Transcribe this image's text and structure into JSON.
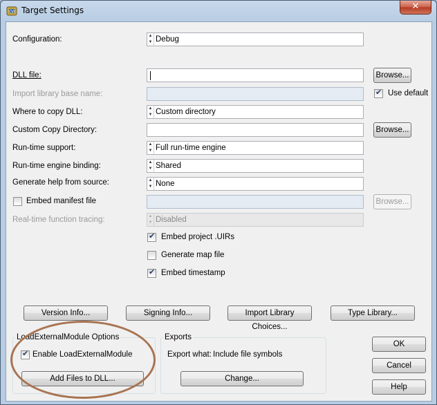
{
  "window": {
    "title": "Target Settings",
    "close_label": "✕"
  },
  "fields": {
    "configuration": {
      "label": "Configuration:",
      "value": "Debug"
    },
    "dll_file": {
      "label": "DLL file:",
      "value": "",
      "browse": "Browse..."
    },
    "import_library": {
      "label": "Import library base name:",
      "value": "",
      "use_default": "Use default",
      "use_default_checked": true
    },
    "where_to_copy": {
      "label": "Where to copy DLL:",
      "value": "Custom directory"
    },
    "custom_copy_dir": {
      "label": "Custom Copy Directory:",
      "value": "",
      "browse": "Browse..."
    },
    "runtime_support": {
      "label": "Run-time support:",
      "value": "Full run-time engine"
    },
    "runtime_binding": {
      "label": "Run-time engine binding:",
      "value": "Shared"
    },
    "generate_help": {
      "label": "Generate help from source:",
      "value": "None"
    },
    "embed_manifest": {
      "label": "Embed manifest file",
      "checked": false,
      "browse": "Browse..."
    },
    "realtime_tracing": {
      "label": "Real-time function tracing:",
      "value": "Disabled"
    }
  },
  "options": {
    "embed_uirs": {
      "label": "Embed project .UIRs",
      "checked": true
    },
    "generate_map": {
      "label": "Generate map file",
      "checked": false
    },
    "embed_timestamp": {
      "label": "Embed timestamp",
      "checked": true
    }
  },
  "buttons": {
    "version_info": "Version Info...",
    "signing_info": "Signing Info...",
    "import_library_choices": "Import Library Choices...",
    "type_library": "Type Library...",
    "ok": "OK",
    "cancel": "Cancel",
    "help": "Help"
  },
  "load_external": {
    "group_title": "LoadExternalModule Options",
    "enable_label": "Enable LoadExternalModule",
    "enable_checked": true,
    "add_files": "Add Files to DLL..."
  },
  "exports": {
    "group_title": "Exports",
    "export_what_label": "Export what:",
    "export_what_value": "Include file symbols",
    "change": "Change..."
  },
  "colors": {
    "annotation_ellipse": "#a97452",
    "window_frame": "#b8cde3"
  }
}
